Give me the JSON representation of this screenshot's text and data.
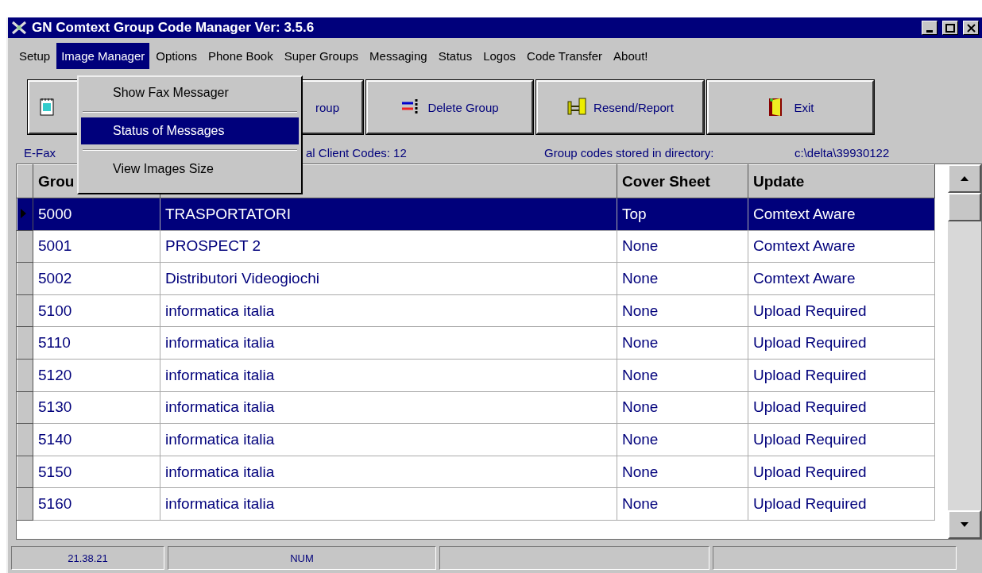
{
  "window": {
    "title": "GN Comtext Group Code Manager Ver: 3.5.6"
  },
  "menu": [
    {
      "label": "Setup",
      "selected": false
    },
    {
      "label": "Image Manager",
      "selected": true
    },
    {
      "label": "Options",
      "selected": false
    },
    {
      "label": "Phone Book",
      "selected": false
    },
    {
      "label": "Super Groups",
      "selected": false
    },
    {
      "label": "Messaging",
      "selected": false
    },
    {
      "label": "Status",
      "selected": false
    },
    {
      "label": "Logos",
      "selected": false
    },
    {
      "label": "Code Transfer",
      "selected": false
    },
    {
      "label": "About!",
      "selected": false
    }
  ],
  "dropdown": [
    {
      "label": "Show Fax Messager",
      "selected": false
    },
    {
      "label": "Status of Messages",
      "selected": true
    },
    {
      "label": "View Images Size",
      "selected": false
    }
  ],
  "toolbar": [
    {
      "kind": "icon"
    },
    {
      "kind": "text",
      "label": "roup"
    },
    {
      "kind": "text",
      "label": "Delete Group"
    },
    {
      "kind": "text",
      "label": "Resend/Report"
    },
    {
      "kind": "text",
      "label": "Exit"
    }
  ],
  "info": {
    "left": "E-Fax",
    "count": "al Client Codes: 12",
    "dir_label": "Group codes stored in directory:",
    "dir": "c:\\delta\\39930122"
  },
  "table": {
    "columns": [
      "Grou",
      null,
      "Cover Sheet",
      "Update"
    ],
    "rows": [
      {
        "selected": true,
        "cells": [
          "5000",
          "TRASPORTATORI",
          "Top",
          "Comtext Aware"
        ]
      },
      {
        "selected": false,
        "cells": [
          "5001",
          "PROSPECT 2",
          "None",
          "Comtext Aware"
        ]
      },
      {
        "selected": false,
        "cells": [
          "5002",
          "Distributori Videogiochi",
          "None",
          "Comtext Aware"
        ]
      },
      {
        "selected": false,
        "cells": [
          "5100",
          "informatica italia",
          "None",
          "Upload Required"
        ]
      },
      {
        "selected": false,
        "cells": [
          "5110",
          "informatica italia",
          "None",
          "Upload Required"
        ]
      },
      {
        "selected": false,
        "cells": [
          "5120",
          "informatica italia",
          "None",
          "Upload Required"
        ]
      },
      {
        "selected": false,
        "cells": [
          "5130",
          "informatica italia",
          "None",
          "Upload Required"
        ]
      },
      {
        "selected": false,
        "cells": [
          "5140",
          "informatica italia",
          "None",
          "Upload Required"
        ]
      },
      {
        "selected": false,
        "cells": [
          "5150",
          "informatica italia",
          "None",
          "Upload Required"
        ]
      },
      {
        "selected": false,
        "cells": [
          "5160",
          "informatica italia",
          "None",
          "Upload Required"
        ]
      }
    ]
  },
  "status_bar": [
    "21.38.21",
    "NUM"
  ]
}
